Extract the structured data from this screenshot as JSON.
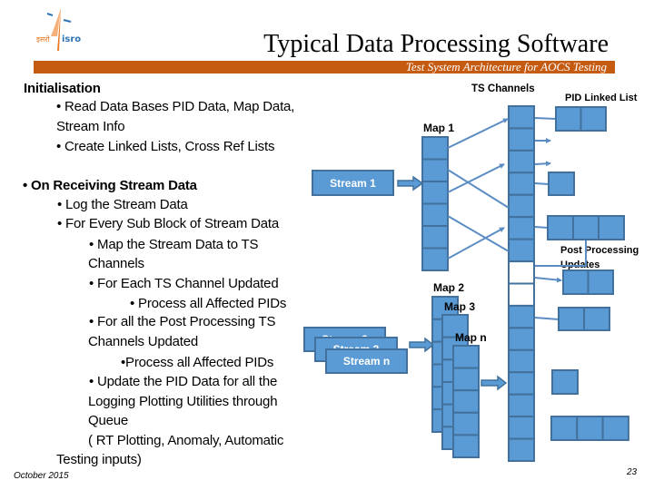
{
  "header": {
    "title": "Typical Data Processing Software",
    "subtitle": "Test System Architecture for AOCS Testing",
    "logo": {
      "hindi": "इसरो",
      "english": "isro"
    }
  },
  "content": {
    "lines": [
      {
        "text": "Initialisation",
        "bold": true
      },
      {
        "text": "• Read Data Bases  PID Data, Map Data,",
        "bold": false
      },
      {
        "text": "Stream Info",
        "bold": false
      },
      {
        "text": "• Create Linked Lists, Cross Ref Lists",
        "bold": false
      },
      {
        "text": "• On Receiving Stream Data",
        "bold": true
      },
      {
        "text": "• Log the Stream Data",
        "bold": false
      },
      {
        "text": "• For Every Sub Block of Stream Data",
        "bold": false
      },
      {
        "text": "• Map the Stream Data to TS",
        "bold": false
      },
      {
        "text": "Channels",
        "bold": false
      },
      {
        "text": "• For Each TS Channel Updated",
        "bold": false
      },
      {
        "text": "• Process all Affected PIDs",
        "bold": false
      },
      {
        "text": "• For all the Post Processing TS",
        "bold": false
      },
      {
        "text": "Channels Updated",
        "bold": false
      },
      {
        "text": "•Process all Affected PIDs",
        "bold": false
      },
      {
        "text": "• Update the PID Data for all the",
        "bold": false
      },
      {
        "text": "Logging Plotting Utilities through",
        "bold": false
      },
      {
        "text": "Queue",
        "bold": false
      },
      {
        "text": "( RT Plotting,  Anomaly, Automatic",
        "bold": false
      },
      {
        "text": "Testing inputs)",
        "bold": false
      }
    ]
  },
  "diagram": {
    "labels": {
      "ts_channels": "TS Channels",
      "pid_linked_list": "PID Linked List",
      "post_processing_1": "Post Processing",
      "post_processing_2": "Updates"
    },
    "streams": [
      "Stream 1",
      "Stream 2",
      "Stream 3",
      "Stream n"
    ],
    "maps": [
      {
        "name": "Map 1",
        "cell_count": 6
      },
      {
        "name": "Map 2",
        "cell_count": 6
      },
      {
        "name": "Map 3",
        "cell_count": 6
      },
      {
        "name": "Map n",
        "cell_count": 5
      }
    ],
    "ts_channels": {
      "cell_count": 16,
      "empty_cells": [
        7,
        8
      ]
    }
  },
  "footer": {
    "date": "October 2015",
    "page": "23"
  },
  "colors": {
    "accent_bar": "#C55A11",
    "block_fill": "#5B9BD5",
    "block_border": "#41719C",
    "connector": "#5B8DC4"
  }
}
